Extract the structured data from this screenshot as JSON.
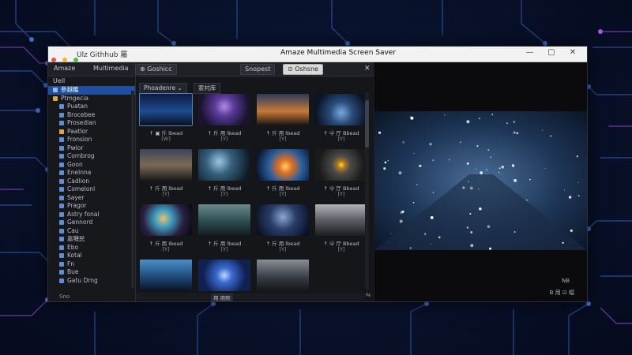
{
  "window": {
    "title": "Amaze Multimedia Screen Saver",
    "app_label": "Ulz Githhub 屬",
    "controls": {
      "minimize": "—",
      "maximize": "▢",
      "close": "✕"
    }
  },
  "toolbar": {
    "tabs": [
      "Amaze",
      "Multimedia",
      "⊕ Goshicc"
    ],
    "buttons": [
      "Snopest",
      "⊙ Oshsne"
    ],
    "close": "✕"
  },
  "sidebar": {
    "header": "Uell",
    "items": [
      {
        "label": "參越鑑",
        "selected": true,
        "top": true,
        "color": "#8fb7ff"
      },
      {
        "label": "Ptmgecia",
        "top": true,
        "color": "#d9a84a"
      },
      {
        "label": "Puatan",
        "color": "#5e8fd6"
      },
      {
        "label": "Brocebee",
        "color": "#5e8fd6"
      },
      {
        "label": "Prosedian",
        "color": "#5e8fd6"
      },
      {
        "label": "Paatlor",
        "color": "#d9a84a"
      },
      {
        "label": "Fronsion",
        "color": "#5e8fd6"
      },
      {
        "label": "Pwlor",
        "color": "#5e8fd6"
      },
      {
        "label": "Cornbrog",
        "color": "#5e8fd6"
      },
      {
        "label": "Goon",
        "color": "#5e8fd6"
      },
      {
        "label": "Enelnna",
        "color": "#5e8fd6"
      },
      {
        "label": "Cadlion",
        "color": "#5e8fd6"
      },
      {
        "label": "Comelonl",
        "color": "#5e8fd6"
      },
      {
        "label": "Sayer",
        "color": "#5e8fd6"
      },
      {
        "label": "Pragor",
        "color": "#5e8fd6"
      },
      {
        "label": "Astry fonal",
        "color": "#5e8fd6"
      },
      {
        "label": "Gennord",
        "color": "#5e8fd6"
      },
      {
        "label": "Cau",
        "color": "#5e8fd6"
      },
      {
        "label": "嘉嘰民",
        "color": "#5e8fd6"
      },
      {
        "label": "Ebo",
        "color": "#5e8fd6"
      },
      {
        "label": "Kotal",
        "color": "#5e8fd6"
      },
      {
        "label": "Fn",
        "color": "#5e8fd6"
      },
      {
        "label": "Bue",
        "color": "#5e8fd6"
      },
      {
        "label": "Gatu Drng",
        "color": "#5e8fd6"
      }
    ],
    "footer": "Sno"
  },
  "breadcrumb": [
    "Phoadenre ⌄",
    "家衬库"
  ],
  "thumbnails": [
    {
      "label": "↑ ▣ 斤 lbead",
      "num": "[W]",
      "theme": "blue"
    },
    {
      "label": "↑ 斤 用 lbead",
      "num": "[Y]",
      "theme": "purple"
    },
    {
      "label": "↑ 斤 用 lbead",
      "num": "[Y]",
      "theme": "sunset"
    },
    {
      "label": "↑ 屮 厅 Bbead",
      "num": "[Y]",
      "theme": "steel"
    },
    {
      "label": "↑ 斤 用 lbead",
      "num": "[Y]",
      "theme": "dusk"
    },
    {
      "label": "↑ 斤 用 lbead",
      "num": "[Y]",
      "theme": "storm"
    },
    {
      "label": "↑ 斤 用 lbead",
      "num": "[Y]",
      "theme": "fire"
    },
    {
      "label": "↑ 屮 厅 Bbead",
      "num": "[Y]",
      "theme": "gear"
    },
    {
      "label": "↑ 斤 用 Ibead",
      "num": "[Y]",
      "theme": "nebula"
    },
    {
      "label": "↑ 斤 用 lbead",
      "num": "[Y]",
      "theme": "teal"
    },
    {
      "label": "↑ 斤 用 lbead",
      "num": "[Y]",
      "theme": "night"
    },
    {
      "label": "↑ 屮 厅 Bbead",
      "num": "[Y]",
      "theme": "grey"
    },
    {
      "label": "",
      "num": "",
      "theme": "city"
    },
    {
      "label": "",
      "num": "",
      "theme": "tunnel"
    },
    {
      "label": "",
      "num": "",
      "theme": "room"
    }
  ],
  "status": {
    "hscroll_label": "用 用熙",
    "corner": "⇆",
    "preview_a": "NB",
    "preview_b": "B 用 ⊡ 幅"
  }
}
